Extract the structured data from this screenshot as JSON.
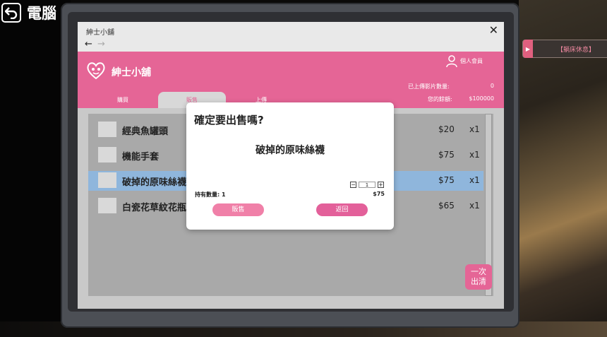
{
  "top": {
    "title": "電腦"
  },
  "notification": {
    "text": "【躺床休息】"
  },
  "window": {
    "title": "紳士小舖",
    "close": "✕",
    "nav_back": "←",
    "nav_forward": "→"
  },
  "shop": {
    "name": "紳士小舖",
    "member": "個人會員",
    "uploaded_label": "已上傳影片數量:",
    "uploaded_value": "0",
    "balance_label": "您的餘額:",
    "balance_value": "$100000",
    "tabs": [
      {
        "label": "購買"
      },
      {
        "label": "販售"
      },
      {
        "label": "上傳"
      }
    ]
  },
  "items": [
    {
      "name": "經典魚罐頭",
      "price": "$20",
      "qty": "x1"
    },
    {
      "name": "機能手套",
      "price": "$75",
      "qty": "x1"
    },
    {
      "name": "破掉的原味絲襪",
      "price": "$75",
      "qty": "x1"
    },
    {
      "name": "白瓷花草紋花瓶",
      "price": "$65",
      "qty": "x1"
    }
  ],
  "clear_button": {
    "line1": "一次",
    "line2": "出清"
  },
  "dialog": {
    "title": "確定要出售嗎?",
    "item": "破掉的原味絲襪",
    "minus": "−",
    "quantity": "1",
    "plus": "+",
    "owned_label": "持有數量: 1",
    "price": "$75",
    "sell_label": "販售",
    "back_label": "返回"
  }
}
